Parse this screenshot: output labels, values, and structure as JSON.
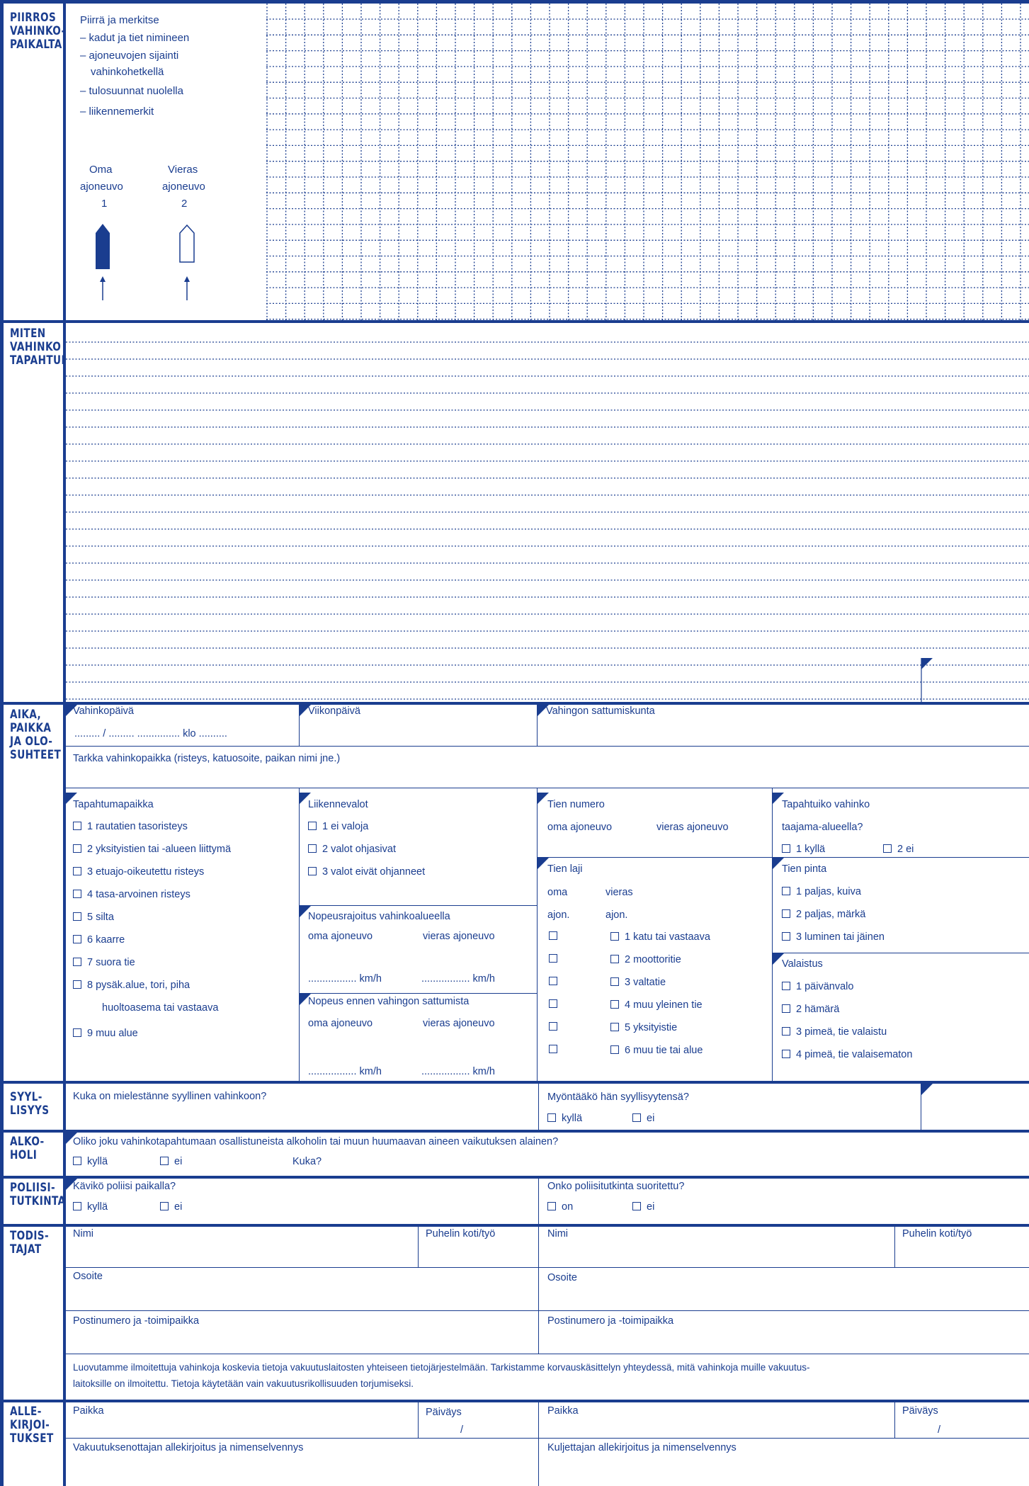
{
  "sections": {
    "sketch": "PIIRROS VAHINKO-PAIKALTA",
    "how": "MITEN VAHINKO TAPAHTUI",
    "time": "AIKA, PAIKKA JA OLO-SUHTEET",
    "guilt": "SYYL-LISYYS",
    "alcohol": "ALKO-HOLI",
    "police": "POLIISI-TUTKINTA",
    "witnesses": "TODIS-TAJAT",
    "signatures": "ALLE-KIRJOI-TUKSET"
  },
  "sketch": {
    "intro": "Piirrä ja merkitse",
    "items": [
      "– kadut ja tiet nimineen",
      "– ajoneuvojen sijainti",
      "vahinkohetkellä",
      "– tulosuunnat nuolella",
      "– liikennemerkit"
    ],
    "own_vehicle": [
      "Oma",
      "ajoneuvo",
      "1"
    ],
    "other_vehicle": [
      "Vieras",
      "ajoneuvo",
      "2"
    ]
  },
  "time": {
    "date_label": "Vahinkopäivä",
    "date_template": "......... / .........  ............... klo ..........",
    "weekday_label": "Viikonpäivä",
    "municipality_label": "Vahingon sattumiskunta",
    "exact_place_label": "Tarkka vahinkopaikka (risteys, katuosoite, paikan nimi jne.)"
  },
  "place": {
    "label": "Tapahtumapaikka",
    "options": [
      "1  rautatien tasoristeys",
      "2  yksityistien tai -alueen liittymä",
      "3  etuajo-oikeutettu risteys",
      "4  tasa-arvoinen risteys",
      "5  silta",
      "6  kaarre",
      "7  suora tie",
      "8  pysäk.alue, tori, piha",
      "9  muu alue"
    ],
    "option8_cont": "huoltoasema tai vastaava"
  },
  "lights": {
    "label": "Liikennevalot",
    "options": [
      "1  ei valoja",
      "2  valot ohjasivat",
      "3  valot eivät ohjanneet"
    ]
  },
  "speedlimit": {
    "label": "Nopeusrajoitus vahinkoalueella",
    "own": "oma ajoneuvo",
    "other": "vieras ajoneuvo",
    "unit_own": "................. km/h",
    "unit_other": "................. km/h"
  },
  "speed": {
    "label": "Nopeus ennen vahingon sattumista",
    "own": "oma ajoneuvo",
    "other": "vieras ajoneuvo",
    "unit_own": "................. km/h",
    "unit_other": "................. km/h"
  },
  "road_number": {
    "label": "Tien numero",
    "own": "oma ajoneuvo",
    "other": "vieras ajoneuvo"
  },
  "road_type": {
    "label": "Tien laji",
    "own1": "oma",
    "own2": "ajon.",
    "other1": "vieras",
    "other2": "ajon.",
    "options": [
      "1  katu tai vastaava",
      "2  moottoritie",
      "3  valtatie",
      "4  muu yleinen tie",
      "5  yksityistie",
      "6  muu tie tai alue"
    ]
  },
  "urban": {
    "label1": "Tapahtuiko vahinko",
    "label2": "taajama-alueella?",
    "yes": "1  kyllä",
    "no": "2  ei"
  },
  "surface": {
    "label": "Tien pinta",
    "options": [
      "1  paljas, kuiva",
      "2  paljas, märkä",
      "3  luminen tai jäinen"
    ]
  },
  "lighting": {
    "label": "Valaistus",
    "options": [
      "1  päivänvalo",
      "2  hämärä",
      "3  pimeä, tie valaistu",
      "4  pimeä, tie valaisematon"
    ]
  },
  "guilt": {
    "question": "Kuka on mielestänne syyllinen vahinkoon?",
    "admit": "Myöntääkö hän syyllisyytensä?",
    "yes": "kyllä",
    "no": "ei"
  },
  "alcohol": {
    "question": "Oliko joku vahinkotapahtumaan osallistuneista alkoholin tai muun huumaavan aineen vaikutuksen alainen?",
    "yes": "kyllä",
    "no": "ei",
    "who": "Kuka?"
  },
  "police": {
    "visited": "Kävikö poliisi paikalla?",
    "investigated": "Onko poliisitutkinta suoritettu?",
    "yes": "kyllä",
    "no": "ei",
    "on": "on",
    "ei": "ei"
  },
  "witnesses": {
    "name": "Nimi",
    "phone": "Puhelin koti/työ",
    "address": "Osoite",
    "postal": "Postinumero ja -toimipaikka",
    "notice": "Luovutamme ilmoitettuja vahinkoja koskevia tietoja vakuutuslaitosten yhteiseen tietojärjestelmään. Tarkistamme korvauskäsittelyn yhteydessä, mitä vahinkoja muille vakuutus-",
    "notice2": "laitoksille on ilmoitettu. Tietoja käytetään vain vakuutusrikollisuuden torjumiseksi."
  },
  "signatures": {
    "place": "Paikka",
    "date": "Päiväys",
    "slash": "/",
    "policyholder": "Vakuutuksenottajan allekirjoitus ja nimenselvennys",
    "driver": "Kuljettajan allekirjoitus ja nimenselvennys"
  },
  "colors": {
    "ink": "#1a3d8f"
  }
}
